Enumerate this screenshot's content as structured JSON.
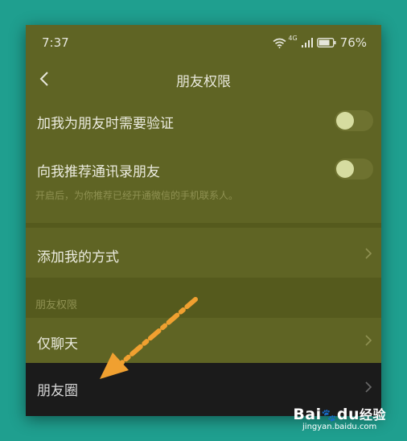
{
  "status": {
    "time": "7:37",
    "network": "4G",
    "battery": "76%"
  },
  "nav": {
    "title": "朋友权限"
  },
  "settings": {
    "verify_label": "加我为朋友时需要验证",
    "verify_on": false,
    "recommend_label": "向我推荐通讯录朋友",
    "recommend_on": false,
    "recommend_hint": "开启后，为你推荐已经开通微信的手机联系人。",
    "add_methods_label": "添加我的方式"
  },
  "permissions": {
    "section_title": "朋友权限",
    "chat_only_label": "仅聊天",
    "moments_label": "朋友圈"
  },
  "colors": {
    "background": "#1f9f8f",
    "screen_overlay": "#5f6424",
    "arrow": "#f0a030",
    "highlight_row": "#1b1b1b"
  },
  "watermark": {
    "brand": "Bai",
    "brand2": "du",
    "cn": "经验",
    "url": "jingyan.baidu.com"
  }
}
